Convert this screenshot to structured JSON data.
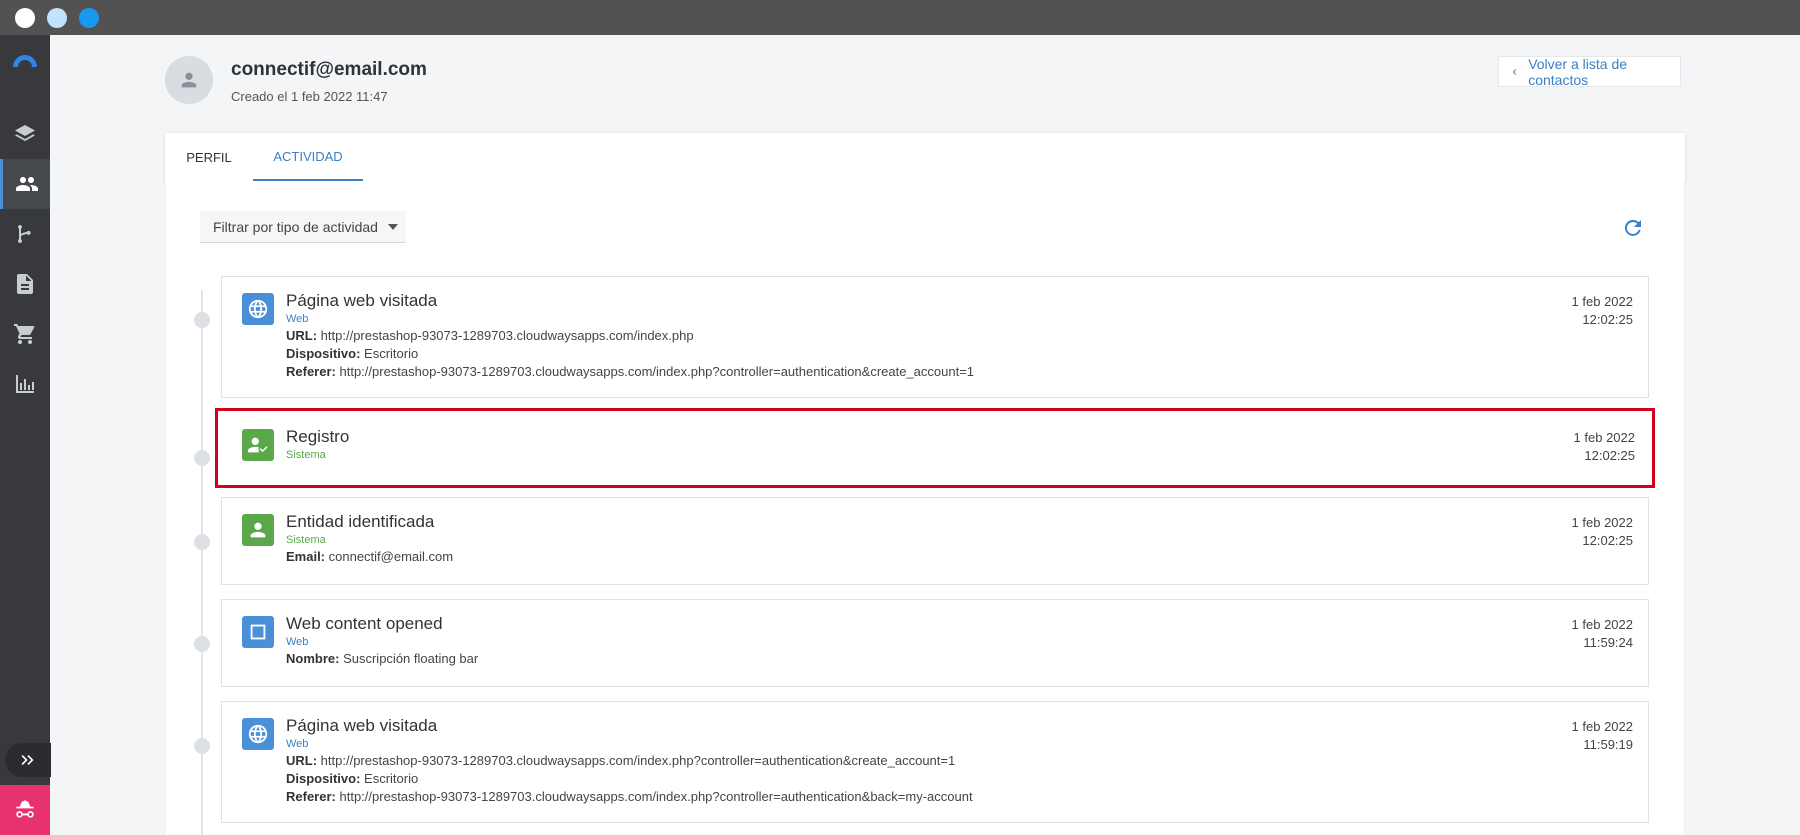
{
  "contact": {
    "email": "connectif@email.com",
    "created": "Creado el 1 feb 2022 11:47",
    "back_label": "Volver a lista de contactos"
  },
  "tabs": [
    {
      "label": "PERFIL",
      "active": false
    },
    {
      "label": "ACTIVIDAD",
      "active": true
    }
  ],
  "filter": {
    "label": "Filtrar por tipo de actividad"
  },
  "colors": {
    "accent": "#3b7fc4",
    "web": "#4a90d9",
    "system": "#5ba84a",
    "highlight": "#d0021b",
    "incognito": "#e8326d"
  },
  "sidebar": {
    "items": [
      {
        "icon": "layers-icon"
      },
      {
        "icon": "contacts-icon",
        "active": true
      },
      {
        "icon": "workflow-icon"
      },
      {
        "icon": "document-icon"
      },
      {
        "icon": "cart-icon"
      },
      {
        "icon": "bar-chart-icon"
      }
    ],
    "expand_icon": "double-chevron-right-icon",
    "incognito_icon": "incognito-icon"
  },
  "activities": [
    {
      "title": "Página web visitada",
      "category": "Web",
      "icon": "globe-icon",
      "date": "1 feb 2022",
      "time": "12:02:25",
      "details": [
        {
          "key": "URL:",
          "value": "http://prestashop-93073-1289703.cloudwaysapps.com/index.php"
        },
        {
          "key": "Dispositivo:",
          "value": "Escritorio"
        },
        {
          "key": "Referer:",
          "value": "http://prestashop-93073-1289703.cloudwaysapps.com/index.php?controller=authentication&create_account=1"
        }
      ]
    },
    {
      "title": "Registro",
      "category": "Sistema",
      "icon": "user-check-icon",
      "date": "1 feb 2022",
      "time": "12:02:25",
      "highlighted": true,
      "details": []
    },
    {
      "title": "Entidad identificada",
      "category": "Sistema",
      "icon": "person-icon",
      "date": "1 feb 2022",
      "time": "12:02:25",
      "details": [
        {
          "key": "Email:",
          "value": "connectif@email.com"
        }
      ]
    },
    {
      "title": "Web content opened",
      "category": "Web",
      "icon": "square-icon",
      "date": "1 feb 2022",
      "time": "11:59:24",
      "details": [
        {
          "key": "Nombre:",
          "value": "Suscripción floating bar"
        }
      ]
    },
    {
      "title": "Página web visitada",
      "category": "Web",
      "icon": "globe-icon",
      "date": "1 feb 2022",
      "time": "11:59:19",
      "details": [
        {
          "key": "URL:",
          "value": "http://prestashop-93073-1289703.cloudwaysapps.com/index.php?controller=authentication&create_account=1"
        },
        {
          "key": "Dispositivo:",
          "value": "Escritorio"
        },
        {
          "key": "Referer:",
          "value": "http://prestashop-93073-1289703.cloudwaysapps.com/index.php?controller=authentication&back=my-account"
        }
      ]
    }
  ]
}
